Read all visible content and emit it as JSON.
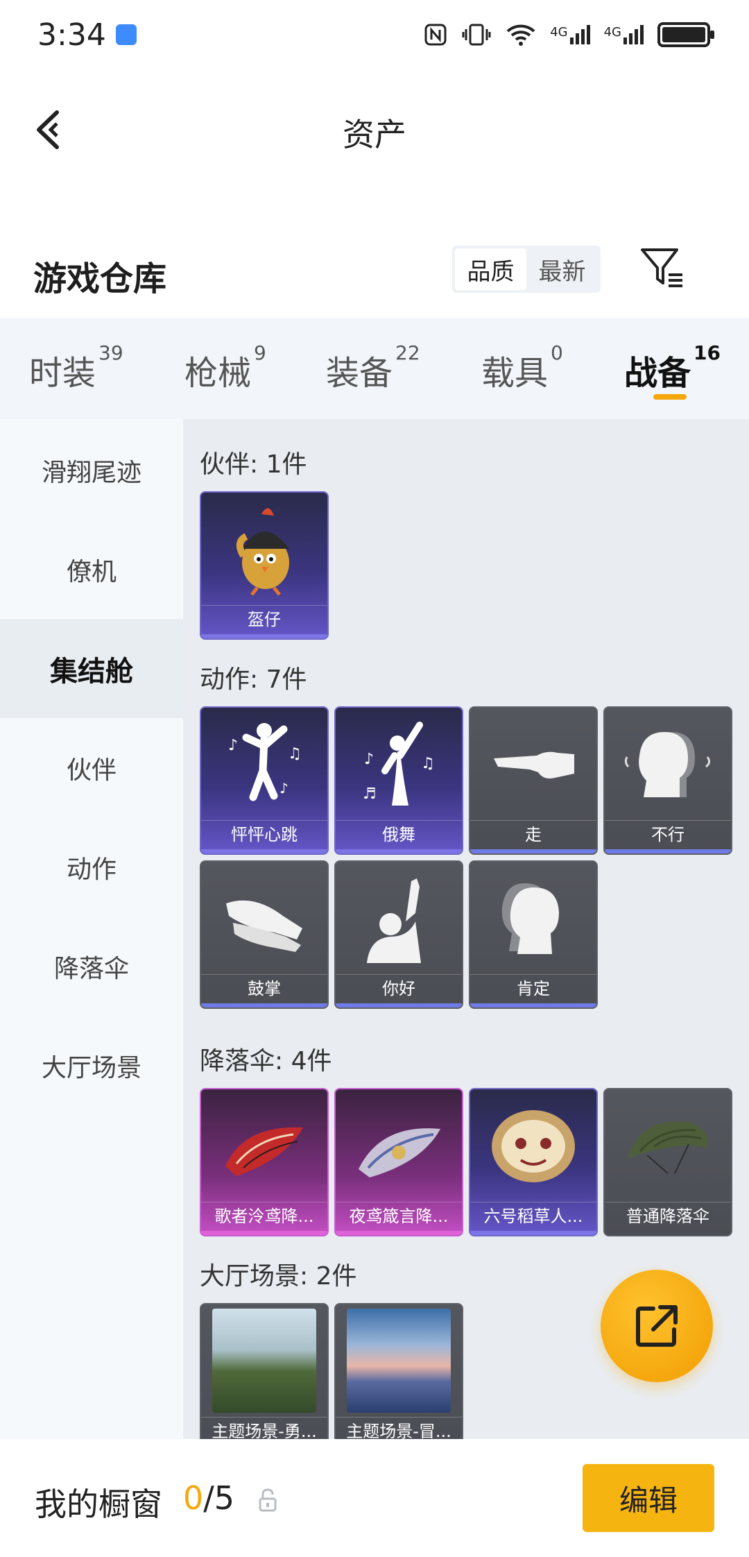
{
  "status_bar": {
    "time": "3:34",
    "network_1": "4G",
    "network_2": "4G"
  },
  "header": {
    "title": "资产"
  },
  "warehouse": {
    "title": "游戏仓库",
    "sort_options": [
      "品质",
      "最新"
    ],
    "active_sort": "品质"
  },
  "category_tabs": [
    {
      "label": "时装",
      "count": "39"
    },
    {
      "label": "枪械",
      "count": "9"
    },
    {
      "label": "装备",
      "count": "22"
    },
    {
      "label": "载具",
      "count": "0"
    },
    {
      "label": "战备",
      "count": "16"
    }
  ],
  "active_category": "战备",
  "side_menu": [
    {
      "label": "滑翔尾迹"
    },
    {
      "label": "僚机"
    },
    {
      "label": "集结舱"
    },
    {
      "label": "伙伴"
    },
    {
      "label": "动作"
    },
    {
      "label": "降落伞"
    },
    {
      "label": "大厅场景"
    }
  ],
  "active_side_item": "集结舱",
  "sections": [
    {
      "title": "伙伴: 1件",
      "items": [
        {
          "name": "盔仔",
          "rarity": "purple"
        }
      ]
    },
    {
      "title": "动作: 7件",
      "items": [
        {
          "name": "怦怦心跳",
          "rarity": "purple"
        },
        {
          "name": "俄舞",
          "rarity": "purple"
        },
        {
          "name": "走",
          "rarity": "gray"
        },
        {
          "name": "不行",
          "rarity": "gray"
        },
        {
          "name": "鼓掌",
          "rarity": "gray"
        },
        {
          "name": "你好",
          "rarity": "gray"
        },
        {
          "name": "肯定",
          "rarity": "gray"
        }
      ]
    },
    {
      "title": "降落伞: 4件",
      "items": [
        {
          "name": "歌者泠鸢降...",
          "rarity": "pink"
        },
        {
          "name": "夜鸢箴言降...",
          "rarity": "pink"
        },
        {
          "name": "六号稻草人...",
          "rarity": "purple"
        },
        {
          "name": "普通降落伞",
          "rarity": "gray"
        }
      ]
    },
    {
      "title": "大厅场景: 2件",
      "items": [
        {
          "name": "主题场景-勇...",
          "rarity": "gray"
        },
        {
          "name": "主题场景-冒...",
          "rarity": "gray"
        }
      ]
    }
  ],
  "showcase": {
    "title": "我的橱窗",
    "current": "0",
    "separator_total": "/5"
  },
  "edit_button": "编辑",
  "colors": {
    "accent": "#f5a80e",
    "purple_rarity": "#6556c8",
    "pink_rarity": "#c44fc4",
    "gray_rarity": "#4f5158"
  },
  "icons": {
    "back": "back-arrow-icon",
    "filter": "filter-icon",
    "share": "share-external-icon",
    "lock": "lock-icon"
  }
}
